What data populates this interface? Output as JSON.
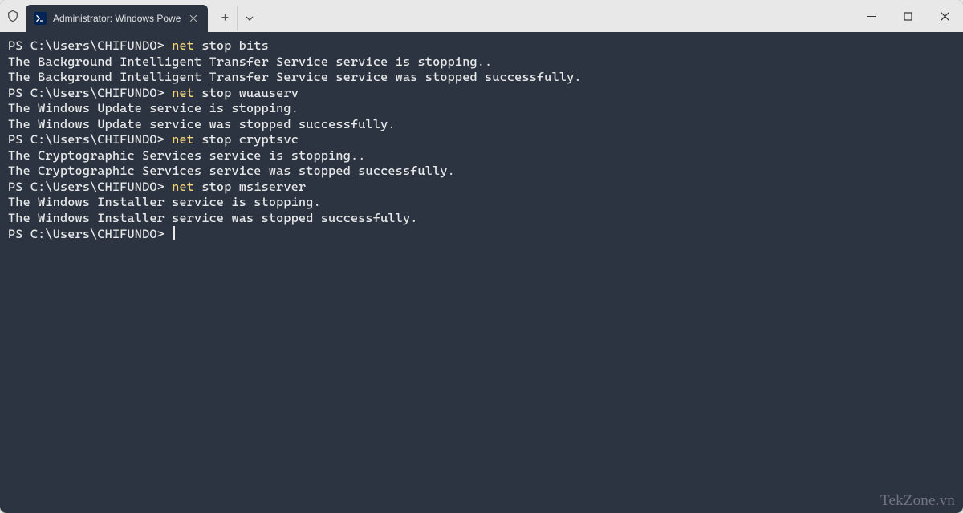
{
  "titlebar": {
    "tab_title": "Administrator: Windows Powe",
    "new_tab_label": "+"
  },
  "terminal": {
    "blocks": [
      {
        "prompt": "PS C:\\Users\\CHIFUNDO> ",
        "cmd": "net",
        "args": " stop bits",
        "output": [
          "The Background Intelligent Transfer Service service is stopping..",
          "The Background Intelligent Transfer Service service was stopped successfully."
        ]
      },
      {
        "prompt": "PS C:\\Users\\CHIFUNDO> ",
        "cmd": "net",
        "args": " stop wuauserv",
        "output": [
          "The Windows Update service is stopping.",
          "The Windows Update service was stopped successfully."
        ]
      },
      {
        "prompt": "PS C:\\Users\\CHIFUNDO> ",
        "cmd": "net",
        "args": " stop cryptsvc",
        "output": [
          "The Cryptographic Services service is stopping..",
          "The Cryptographic Services service was stopped successfully."
        ]
      },
      {
        "prompt": "PS C:\\Users\\CHIFUNDO> ",
        "cmd": "net",
        "args": " stop msiserver",
        "output": [
          "The Windows Installer service is stopping.",
          "The Windows Installer service was stopped successfully."
        ]
      }
    ],
    "final_prompt": "PS C:\\Users\\CHIFUNDO> "
  },
  "watermark": "TekZone.vn"
}
